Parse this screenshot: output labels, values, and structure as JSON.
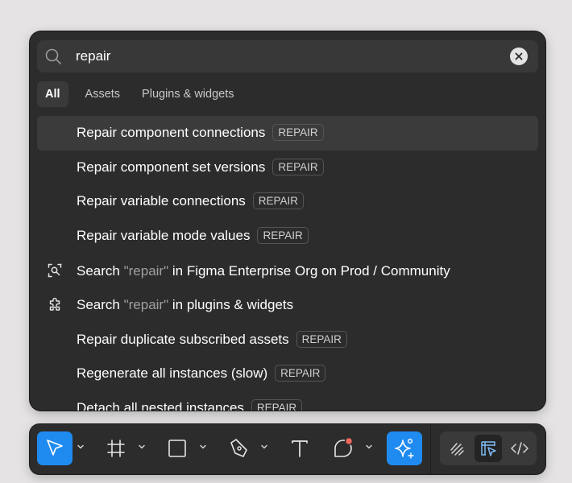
{
  "search": {
    "query": "repair",
    "placeholder": ""
  },
  "tabs": [
    {
      "label": "All"
    },
    {
      "label": "Assets"
    },
    {
      "label": "Plugins & widgets"
    }
  ],
  "results": [
    {
      "label": "Repair component connections",
      "badge": "REPAIR"
    },
    {
      "label": "Repair component set versions",
      "badge": "REPAIR"
    },
    {
      "label": "Repair variable connections",
      "badge": "REPAIR"
    },
    {
      "label": "Repair variable mode values",
      "badge": "REPAIR"
    },
    {
      "prefix": "Search ",
      "query": "\"repair\"",
      "suffix": " in Figma Enterprise Org on Prod / Community",
      "icon": "search-community-icon"
    },
    {
      "prefix": "Search ",
      "query": "\"repair\"",
      "suffix": " in plugins & widgets",
      "icon": "plugin-icon"
    },
    {
      "label": "Repair duplicate subscribed assets",
      "badge": "REPAIR"
    },
    {
      "label": "Regenerate all instances (slow)",
      "badge": "REPAIR"
    },
    {
      "label": "Detach all nested instances",
      "badge": "REPAIR"
    }
  ],
  "toolbar": {
    "tools": [
      "move-tool",
      "frame-tool",
      "shape-tool",
      "pen-tool",
      "text-tool",
      "comment-tool",
      "ai-actions-tool"
    ],
    "modes": [
      "draw-mode",
      "design-mode",
      "dev-mode"
    ]
  },
  "colors": {
    "accent": "#1f8bf0",
    "panel": "#2c2c2c",
    "highlight": "#3b3b3b",
    "notification_dot": "#f0665b"
  }
}
